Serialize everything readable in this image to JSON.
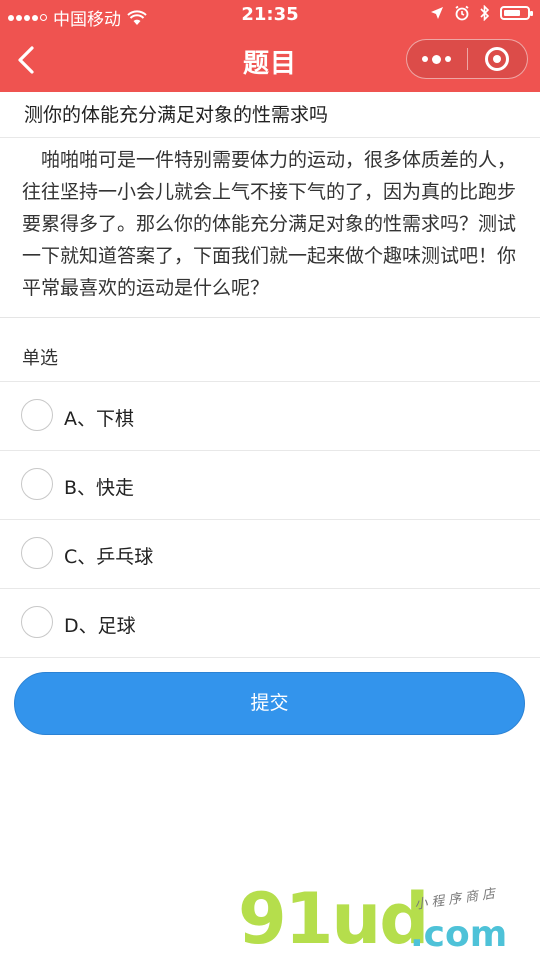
{
  "status_bar": {
    "carrier": "中国移动",
    "time": "21:35"
  },
  "nav": {
    "title": "题目"
  },
  "question": {
    "title": "测你的体能充分满足对象的性需求吗",
    "description": "啪啪啪可是一件特别需要体力的运动，很多体质差的人，往往坚持一小会儿就会上气不接下气的了，因为真的比跑步要累得多了。那么你的体能充分满足对象的性需求吗？测试一下就知道答案了，下面我们就一起来做个趣味测试吧！你平常最喜欢的运动是什么呢？",
    "type_label": "单选",
    "options": [
      {
        "label": "A、下棋"
      },
      {
        "label": "B、快走"
      },
      {
        "label": "C、乒乓球"
      },
      {
        "label": "D、足球"
      }
    ]
  },
  "submit": {
    "label": "提交"
  },
  "watermark": {
    "main": "91ud",
    "suffix": ".com",
    "sub": "小程序商店"
  },
  "colors": {
    "header": "#ef5350",
    "button": "#3394ec"
  }
}
